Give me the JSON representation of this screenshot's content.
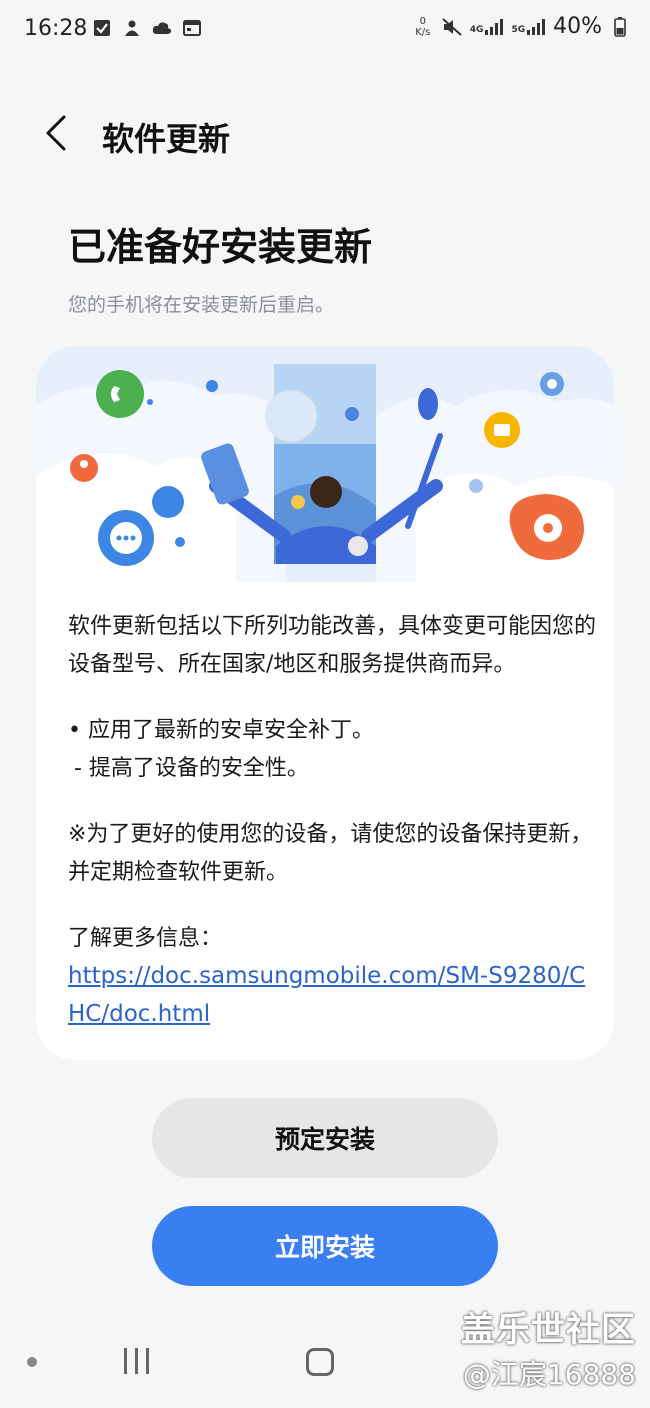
{
  "status_bar": {
    "time": "16:28",
    "net_speed_value": "0",
    "net_speed_unit": "K/s",
    "net1": "4G",
    "net2": "5G",
    "battery": "40%"
  },
  "header": {
    "title": "软件更新"
  },
  "main": {
    "heading": "已准备好安装更新",
    "subtitle": "您的手机将在安装更新后重启。"
  },
  "card": {
    "intro": "软件更新包括以下所列功能改善，具体变更可能因您的设备型号、所在国家/地区和服务提供商而异。",
    "bullet1": "• 应用了最新的安卓安全补丁。",
    "bullet1_sub": " - 提高了设备的安全性。",
    "note": "※为了更好的使用您的设备，请使您的设备保持更新，并定期检查软件更新。",
    "more_label": "了解更多信息：",
    "link": "https://doc.samsungmobile.com/SM-S9280/CHC/doc.html"
  },
  "buttons": {
    "schedule": "预定安装",
    "install_now": "立即安装"
  },
  "watermark": {
    "line1": "盖乐世社区",
    "line2": "@江宸16888"
  },
  "colors": {
    "accent": "#3a7ff1",
    "link": "#2b63c9",
    "background": "#f5f6f8"
  }
}
